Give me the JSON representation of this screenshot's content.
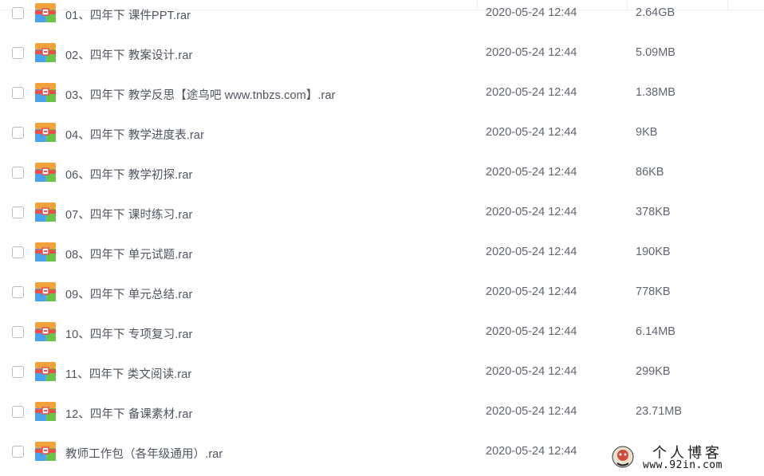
{
  "files": [
    {
      "name": "01、四年下 课件PPT.rar",
      "modified": "2020-05-24 12:44",
      "size": "2.64GB"
    },
    {
      "name": "02、四年下 教案设计.rar",
      "modified": "2020-05-24 12:44",
      "size": "5.09MB"
    },
    {
      "name": "03、四年下 教学反思【途鸟吧 www.tnbzs.com】.rar",
      "modified": "2020-05-24 12:44",
      "size": "1.38MB"
    },
    {
      "name": "04、四年下 教学进度表.rar",
      "modified": "2020-05-24 12:44",
      "size": "9KB"
    },
    {
      "name": "06、四年下 教学初探.rar",
      "modified": "2020-05-24 12:44",
      "size": "86KB"
    },
    {
      "name": "07、四年下 课时练习.rar",
      "modified": "2020-05-24 12:44",
      "size": "378KB"
    },
    {
      "name": "08、四年下 单元试题.rar",
      "modified": "2020-05-24 12:44",
      "size": "190KB"
    },
    {
      "name": "09、四年下 单元总结.rar",
      "modified": "2020-05-24 12:44",
      "size": "778KB"
    },
    {
      "name": "10、四年下 专项复习.rar",
      "modified": "2020-05-24 12:44",
      "size": "6.14MB"
    },
    {
      "name": "11、四年下 类文阅读.rar",
      "modified": "2020-05-24 12:44",
      "size": "299KB"
    },
    {
      "name": "12、四年下 备课素材.rar",
      "modified": "2020-05-24 12:44",
      "size": "23.71MB"
    },
    {
      "name": "教师工作包（各年级通用）.rar",
      "modified": "2020-05-24 12:44",
      "size": ""
    }
  ],
  "file_icon": "rar-archive-icon",
  "watermark": {
    "title": "个人博客",
    "url": "www.92in.com",
    "logo_icon": "blog-logo-icon"
  },
  "colors": {
    "icon_top": "#f2a23a",
    "icon_band": "#e8524a",
    "icon_left": "#4aa3e8",
    "icon_right": "#6cc24a",
    "text": "#4d5460"
  }
}
